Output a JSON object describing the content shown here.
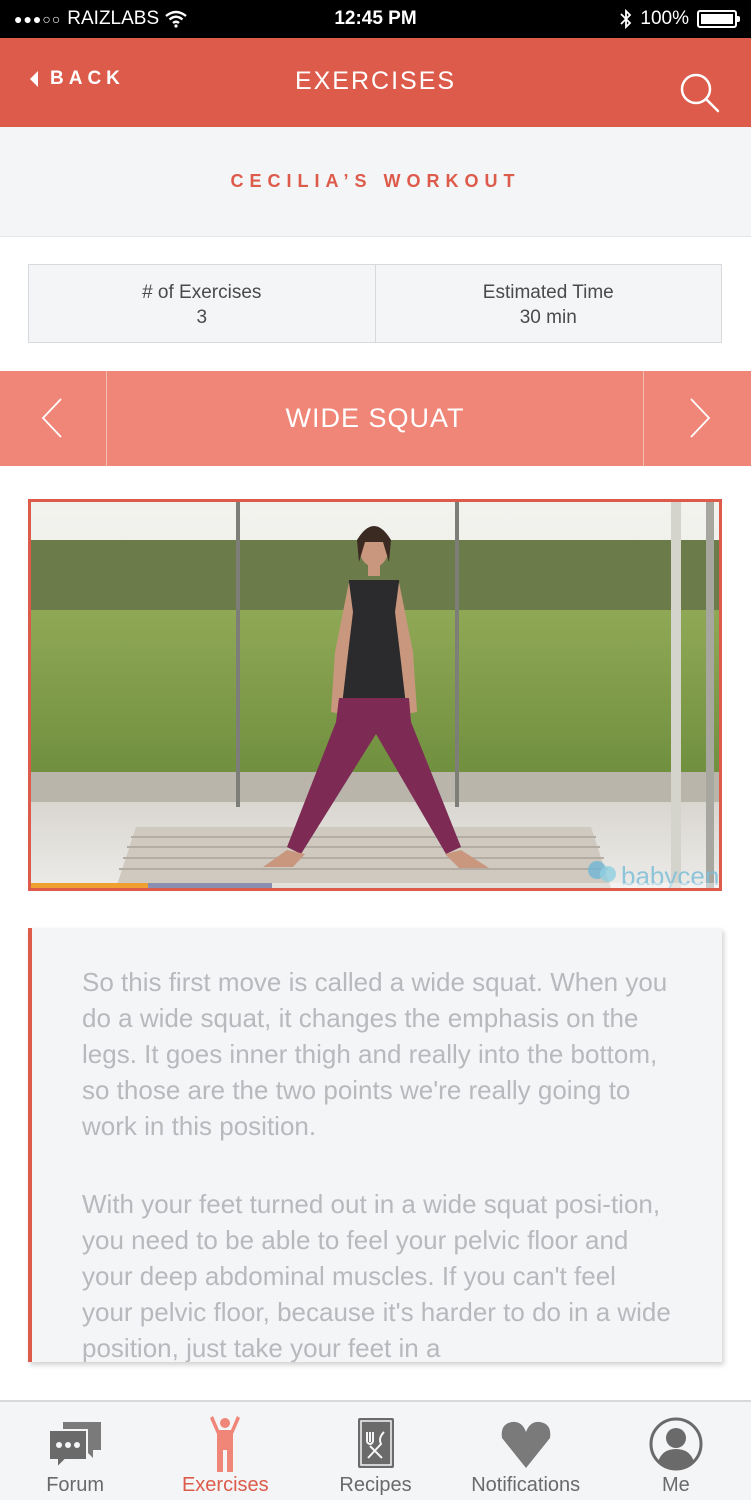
{
  "status_bar": {
    "signal_icon": "signal-dots-icon",
    "carrier": "RAIZLABS",
    "wifi_icon": "wifi-icon",
    "time": "12:45 PM",
    "bluetooth_icon": "bluetooth-icon",
    "battery_percent": "100%",
    "battery_level": 1.0
  },
  "nav": {
    "back_label": "BACK",
    "title": "EXERCISES",
    "search_icon": "search-icon"
  },
  "workout": {
    "title": "CECILIA’S WORKOUT"
  },
  "stats": {
    "exercises_label": "# of Exercises",
    "exercises_value": "3",
    "time_label": "Estimated Time",
    "time_value": "30 min"
  },
  "exercise": {
    "title": "WIDE SQUAT",
    "prev_icon": "chevron-left-icon",
    "next_icon": "chevron-right-icon"
  },
  "video": {
    "progress": 0.17,
    "buffered": 0.35
  },
  "description": {
    "paragraphs": [
      "So this first move is called a wide squat. When you do a wide squat, it changes the emphasis on the legs. It goes inner thigh and really into the bottom, so those are the two points we're really going to work in this position.",
      "With your feet turned out in a wide squat posi-tion, you need to be able to feel your pelvic floor and your deep abdominal muscles. If you can't feel your pelvic floor, because it's harder to do in a wide position, just take your feet in a"
    ]
  },
  "tabs": [
    {
      "label": "Forum",
      "icon": "chat-bubbles-icon"
    },
    {
      "label": "Exercises",
      "icon": "exercise-figure-icon",
      "active": true
    },
    {
      "label": "Recipes",
      "icon": "recipe-book-icon"
    },
    {
      "label": "Notifications",
      "icon": "heart-icon"
    },
    {
      "label": "Me",
      "icon": "profile-icon"
    }
  ],
  "colors": {
    "brand": "#dd5b4b",
    "selector": "#f08677",
    "background": "#f4f5f7"
  }
}
